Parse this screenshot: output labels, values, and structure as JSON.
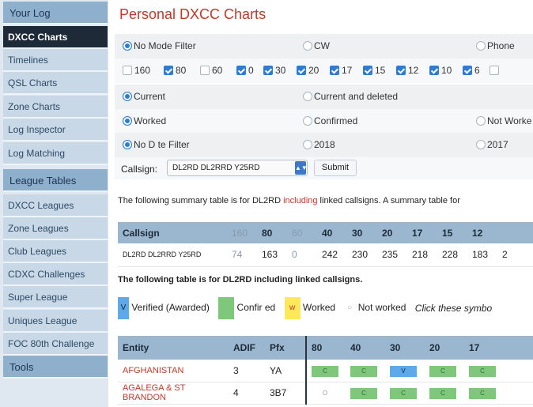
{
  "sidebar": {
    "items": [
      {
        "label": "Your Log",
        "kind": "header"
      },
      {
        "label": "DXCC Charts",
        "kind": "active"
      },
      {
        "label": "Timelines",
        "kind": "item"
      },
      {
        "label": "QSL Charts",
        "kind": "item"
      },
      {
        "label": "Zone Charts",
        "kind": "item"
      },
      {
        "label": "Log Inspector",
        "kind": "item"
      },
      {
        "label": "Log Matching",
        "kind": "item"
      },
      {
        "label": "League Tables",
        "kind": "header"
      },
      {
        "label": "DXCC Leagues",
        "kind": "item"
      },
      {
        "label": "Zone Leagues",
        "kind": "item"
      },
      {
        "label": "Club Leagues",
        "kind": "item"
      },
      {
        "label": "CDXC Challenges",
        "kind": "item"
      },
      {
        "label": "Super League",
        "kind": "item"
      },
      {
        "label": "Uniques League",
        "kind": "item"
      },
      {
        "label": "FOC 80th Challenge",
        "kind": "item"
      },
      {
        "label": "Tools",
        "kind": "header"
      }
    ]
  },
  "main": {
    "title": "Personal DXCC Charts",
    "mode_filter": {
      "options": [
        "No Mode Filter",
        "CW",
        "Phone"
      ],
      "selected": "No Mode Filter"
    },
    "bands": [
      {
        "label": "160",
        "checked": false
      },
      {
        "label": "80",
        "checked": true
      },
      {
        "label": "60",
        "checked": false
      },
      {
        "label": "0",
        "checked": true
      },
      {
        "label": "30",
        "checked": true
      },
      {
        "label": "20",
        "checked": true
      },
      {
        "label": "17",
        "checked": true
      },
      {
        "label": "15",
        "checked": true
      },
      {
        "label": "12",
        "checked": true
      },
      {
        "label": "10",
        "checked": true
      },
      {
        "label": "6",
        "checked": true
      },
      {
        "label": "",
        "checked": false
      }
    ],
    "status_filter": {
      "options": [
        "Current",
        "Current and deleted"
      ],
      "selected": "Current"
    },
    "worked_filter": {
      "options": [
        "Worked",
        "Confirmed",
        "Not Worke"
      ],
      "selected": "Worked"
    },
    "date_filter": {
      "options": [
        "No D te Filter",
        "2018",
        "2017"
      ],
      "selected": "No D te Filter"
    },
    "callsign": {
      "label": "Callsign:",
      "value": "DL2RD DL2RRD Y25RD",
      "submit_label": "Submit"
    },
    "summary_text": {
      "before": "The following summary table is for DL2RD ",
      "highlight": "including",
      "after": " linked callsigns. A summary table for"
    },
    "summary_table": {
      "headers": [
        "Callsign",
        "160",
        "80",
        "60",
        "40",
        "30",
        "20",
        "17",
        "15",
        "12",
        ""
      ],
      "row": [
        "DL2RD DL2RRD Y25RD",
        "74",
        "163",
        "0",
        "242",
        "230",
        "235",
        "218",
        "228",
        "183",
        "2"
      ]
    },
    "linked_text": "The following table is for DL2RD including linked callsigns.",
    "legend": {
      "verified_symbol": "V",
      "verified_label": "Verified (Awarded)",
      "confirmed_label": "Confir  ed",
      "worked_symbol": "w",
      "worked_label": "Worked",
      "not_worked_label": "Not worked",
      "hint": "Click these symbo"
    },
    "entity_table": {
      "headers": [
        "Entity",
        "ADIF",
        "Pfx",
        "80",
        "40",
        "30",
        "20",
        "17"
      ],
      "rows": [
        {
          "entity": "AFGHANISTAN",
          "adif": "3",
          "pfx": "YA",
          "cells": [
            "C",
            "C",
            "V",
            "C",
            "C"
          ]
        },
        {
          "entity": "AGALEGA & ST BRANDON",
          "adif": "4",
          "pfx": "3B7",
          "cells": [
            "O",
            "C",
            "C",
            "C",
            "C"
          ]
        }
      ]
    }
  },
  "colors": {
    "accent_red": "#c0392b",
    "active_nav": "#1e2a38",
    "table_header": "#9bb7cf",
    "verified_blue": "#5da9e9",
    "confirmed_green": "#7fc77a",
    "worked_yellow": "#ffe85a"
  }
}
